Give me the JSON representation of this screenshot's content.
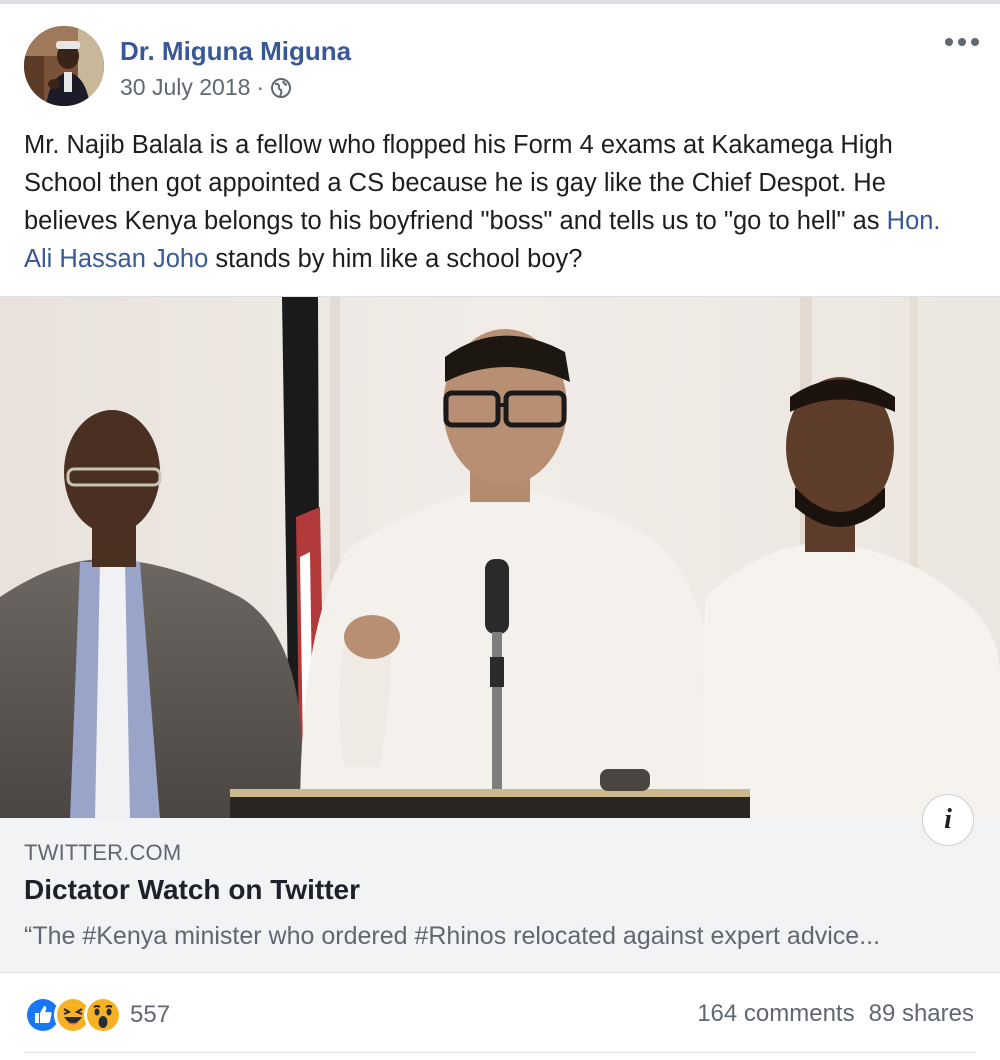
{
  "post": {
    "author": "Dr. Miguna Miguna",
    "date": "30 July 2018",
    "separator": " ·",
    "privacy_icon": "globe-icon",
    "text_part1": "Mr. Najib Balala is a fellow who flopped his Form 4 exams at Kakamega High School then got appointed a CS because he is gay like the Chief Despot. He believes Kenya belongs to his boyfriend \"boss\" and tells us to \"go to hell\" as ",
    "mention": "Hon. Ali Hassan Joho",
    "text_part2": " stands by him like a school boy?"
  },
  "link_preview": {
    "domain": "TWITTER.COM",
    "title": "Dictator Watch on Twitter",
    "description": "“The #Kenya minister who ordered #Rhinos relocated against expert advice..."
  },
  "engagement": {
    "reactions_count": "557",
    "reaction_icons": [
      "like-icon",
      "haha-icon",
      "wow-icon"
    ],
    "comments": "164 comments",
    "shares": "89 shares"
  },
  "colors": {
    "link": "#385898",
    "meta": "#606770",
    "preview_bg": "#f2f3f5",
    "like_blue": "#1877f2",
    "emoji_yellow": "#f7b125"
  }
}
